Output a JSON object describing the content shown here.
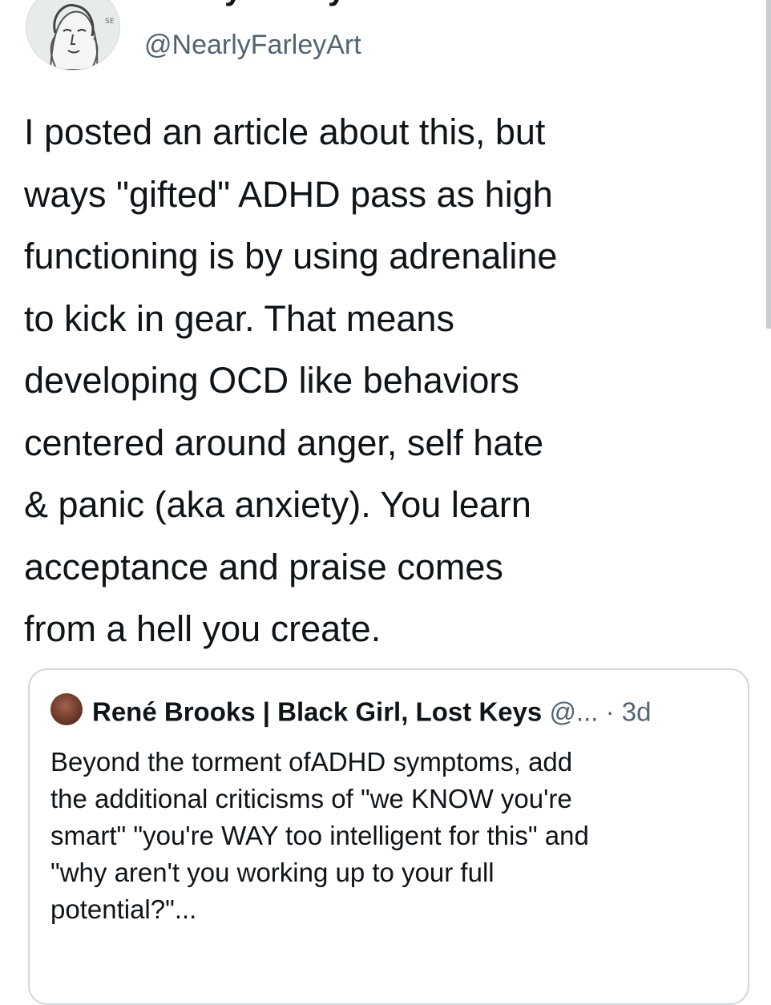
{
  "tweet": {
    "display_name": "Nearly Farley",
    "handle": "@NearlyFarleyArt",
    "name_icons": [
      "leaf-icon",
      "leaf-icon",
      "leaf-icon"
    ],
    "text": "I posted an article about this, but\nways \"gifted\" ADHD pass as high\nfunctioning is by using adrenaline\nto kick in gear. That means\ndeveloping OCD like behaviors\ncentered around anger, self hate\n& panic (aka anxiety). You learn\nacceptance and praise comes\nfrom a hell you create."
  },
  "quoted_tweet": {
    "author_name": "René Brooks | Black Girl, Lost Keys",
    "handle": "@...",
    "separator": "·",
    "timestamp": "3d",
    "text": "Beyond the torment ofADHD symptoms, add\nthe additional criticisms of \"we KNOW you're\nsmart\" \"you're WAY too intelligent for this\" and\n\"why aren't you working up to your full\npotential?\"..."
  },
  "colors": {
    "text": "#0f1419",
    "secondary": "#536471",
    "border": "#d2d7db",
    "leaf": "#7bb24f"
  }
}
